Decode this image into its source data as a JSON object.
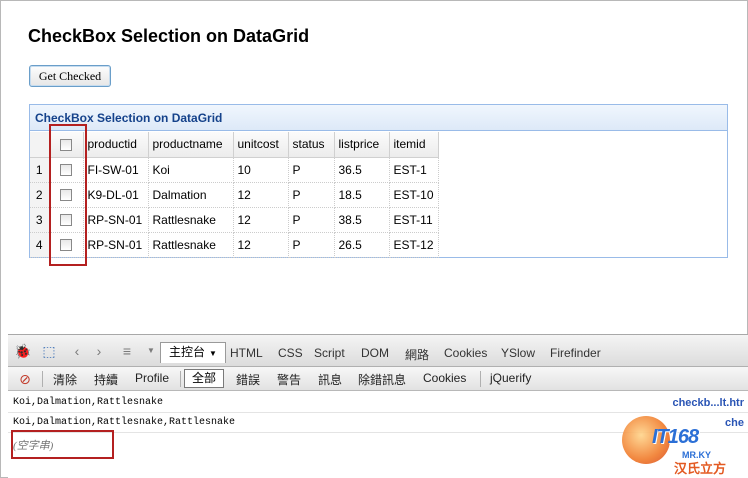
{
  "page": {
    "title": "CheckBox Selection on DataGrid",
    "get_checked_label": "Get Checked"
  },
  "grid": {
    "title": "CheckBox Selection on DataGrid",
    "columns": [
      "productid",
      "productname",
      "unitcost",
      "status",
      "listprice",
      "itemid"
    ],
    "rows": [
      {
        "num": "1",
        "productid": "FI-SW-01",
        "productname": "Koi",
        "unitcost": "10",
        "status": "P",
        "listprice": "36.5",
        "itemid": "EST-1"
      },
      {
        "num": "2",
        "productid": "K9-DL-01",
        "productname": "Dalmation",
        "unitcost": "12",
        "status": "P",
        "listprice": "18.5",
        "itemid": "EST-10"
      },
      {
        "num": "3",
        "productid": "RP-SN-01",
        "productname": "Rattlesnake",
        "unitcost": "12",
        "status": "P",
        "listprice": "38.5",
        "itemid": "EST-11"
      },
      {
        "num": "4",
        "productid": "RP-SN-01",
        "productname": "Rattlesnake",
        "unitcost": "12",
        "status": "P",
        "listprice": "26.5",
        "itemid": "EST-12"
      }
    ]
  },
  "firebug": {
    "console_tab": "主控台",
    "tabs": [
      "HTML",
      "CSS",
      "Script",
      "DOM",
      "網路",
      "Cookies",
      "YSlow",
      "Firefinder"
    ],
    "subtoolbar": {
      "clear": "清除",
      "persist": "持續",
      "profile": "Profile",
      "all": "全部",
      "errors": "錯誤",
      "warnings": "警告",
      "info": "訊息",
      "debug": "除錯訊息",
      "cookies": "Cookies",
      "jquerify": "jQuerify"
    },
    "log": [
      {
        "text": "Koi,Dalmation,Rattlesnake",
        "source": "checkb...lt.htr"
      },
      {
        "text": "Koi,Dalmation,Rattlesnake,Rattlesnake",
        "source": "che"
      }
    ],
    "command_placeholder": "(空字串)"
  },
  "watermark": {
    "brand": "IT168",
    "sub": "MR.KY",
    "cn": "汉氏立方"
  }
}
